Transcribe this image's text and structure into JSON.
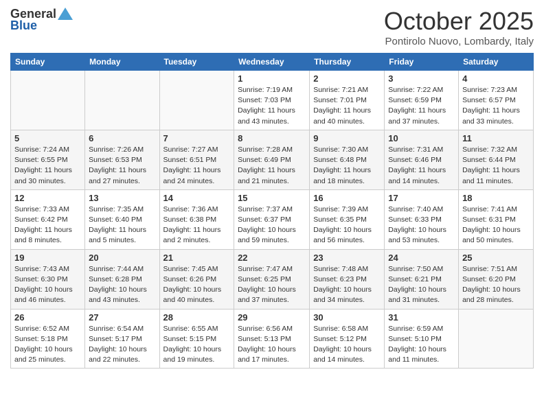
{
  "header": {
    "logo_general": "General",
    "logo_blue": "Blue",
    "month_title": "October 2025",
    "subtitle": "Pontirolo Nuovo, Lombardy, Italy"
  },
  "calendar": {
    "days_of_week": [
      "Sunday",
      "Monday",
      "Tuesday",
      "Wednesday",
      "Thursday",
      "Friday",
      "Saturday"
    ],
    "weeks": [
      [
        {
          "day": "",
          "info": ""
        },
        {
          "day": "",
          "info": ""
        },
        {
          "day": "",
          "info": ""
        },
        {
          "day": "1",
          "info": "Sunrise: 7:19 AM\nSunset: 7:03 PM\nDaylight: 11 hours and 43 minutes."
        },
        {
          "day": "2",
          "info": "Sunrise: 7:21 AM\nSunset: 7:01 PM\nDaylight: 11 hours and 40 minutes."
        },
        {
          "day": "3",
          "info": "Sunrise: 7:22 AM\nSunset: 6:59 PM\nDaylight: 11 hours and 37 minutes."
        },
        {
          "day": "4",
          "info": "Sunrise: 7:23 AM\nSunset: 6:57 PM\nDaylight: 11 hours and 33 minutes."
        }
      ],
      [
        {
          "day": "5",
          "info": "Sunrise: 7:24 AM\nSunset: 6:55 PM\nDaylight: 11 hours and 30 minutes."
        },
        {
          "day": "6",
          "info": "Sunrise: 7:26 AM\nSunset: 6:53 PM\nDaylight: 11 hours and 27 minutes."
        },
        {
          "day": "7",
          "info": "Sunrise: 7:27 AM\nSunset: 6:51 PM\nDaylight: 11 hours and 24 minutes."
        },
        {
          "day": "8",
          "info": "Sunrise: 7:28 AM\nSunset: 6:49 PM\nDaylight: 11 hours and 21 minutes."
        },
        {
          "day": "9",
          "info": "Sunrise: 7:30 AM\nSunset: 6:48 PM\nDaylight: 11 hours and 18 minutes."
        },
        {
          "day": "10",
          "info": "Sunrise: 7:31 AM\nSunset: 6:46 PM\nDaylight: 11 hours and 14 minutes."
        },
        {
          "day": "11",
          "info": "Sunrise: 7:32 AM\nSunset: 6:44 PM\nDaylight: 11 hours and 11 minutes."
        }
      ],
      [
        {
          "day": "12",
          "info": "Sunrise: 7:33 AM\nSunset: 6:42 PM\nDaylight: 11 hours and 8 minutes."
        },
        {
          "day": "13",
          "info": "Sunrise: 7:35 AM\nSunset: 6:40 PM\nDaylight: 11 hours and 5 minutes."
        },
        {
          "day": "14",
          "info": "Sunrise: 7:36 AM\nSunset: 6:38 PM\nDaylight: 11 hours and 2 minutes."
        },
        {
          "day": "15",
          "info": "Sunrise: 7:37 AM\nSunset: 6:37 PM\nDaylight: 10 hours and 59 minutes."
        },
        {
          "day": "16",
          "info": "Sunrise: 7:39 AM\nSunset: 6:35 PM\nDaylight: 10 hours and 56 minutes."
        },
        {
          "day": "17",
          "info": "Sunrise: 7:40 AM\nSunset: 6:33 PM\nDaylight: 10 hours and 53 minutes."
        },
        {
          "day": "18",
          "info": "Sunrise: 7:41 AM\nSunset: 6:31 PM\nDaylight: 10 hours and 50 minutes."
        }
      ],
      [
        {
          "day": "19",
          "info": "Sunrise: 7:43 AM\nSunset: 6:30 PM\nDaylight: 10 hours and 46 minutes."
        },
        {
          "day": "20",
          "info": "Sunrise: 7:44 AM\nSunset: 6:28 PM\nDaylight: 10 hours and 43 minutes."
        },
        {
          "day": "21",
          "info": "Sunrise: 7:45 AM\nSunset: 6:26 PM\nDaylight: 10 hours and 40 minutes."
        },
        {
          "day": "22",
          "info": "Sunrise: 7:47 AM\nSunset: 6:25 PM\nDaylight: 10 hours and 37 minutes."
        },
        {
          "day": "23",
          "info": "Sunrise: 7:48 AM\nSunset: 6:23 PM\nDaylight: 10 hours and 34 minutes."
        },
        {
          "day": "24",
          "info": "Sunrise: 7:50 AM\nSunset: 6:21 PM\nDaylight: 10 hours and 31 minutes."
        },
        {
          "day": "25",
          "info": "Sunrise: 7:51 AM\nSunset: 6:20 PM\nDaylight: 10 hours and 28 minutes."
        }
      ],
      [
        {
          "day": "26",
          "info": "Sunrise: 6:52 AM\nSunset: 5:18 PM\nDaylight: 10 hours and 25 minutes."
        },
        {
          "day": "27",
          "info": "Sunrise: 6:54 AM\nSunset: 5:17 PM\nDaylight: 10 hours and 22 minutes."
        },
        {
          "day": "28",
          "info": "Sunrise: 6:55 AM\nSunset: 5:15 PM\nDaylight: 10 hours and 19 minutes."
        },
        {
          "day": "29",
          "info": "Sunrise: 6:56 AM\nSunset: 5:13 PM\nDaylight: 10 hours and 17 minutes."
        },
        {
          "day": "30",
          "info": "Sunrise: 6:58 AM\nSunset: 5:12 PM\nDaylight: 10 hours and 14 minutes."
        },
        {
          "day": "31",
          "info": "Sunrise: 6:59 AM\nSunset: 5:10 PM\nDaylight: 10 hours and 11 minutes."
        },
        {
          "day": "",
          "info": ""
        }
      ]
    ]
  }
}
